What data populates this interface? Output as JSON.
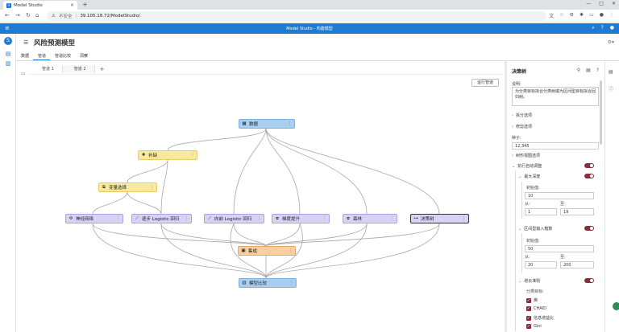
{
  "browser": {
    "tab_title": "Model Studio",
    "tab_close": "×",
    "new_tab": "+",
    "security": "不安全",
    "url": "39.105.18.72/ModelStudio/"
  },
  "app": {
    "title": "Model Studio - 构建模型"
  },
  "project": {
    "title": "风险预测模型",
    "tabs": [
      "数据",
      "管道",
      "管道比较",
      "洞察"
    ]
  },
  "pipeline_tabs": [
    "管道 1",
    "管道 2"
  ],
  "pipeline_add": "+",
  "canvas": {
    "run_button": "运行管道",
    "nodes": {
      "data": "数据",
      "impute": "补缺",
      "varsel": "变量选择",
      "nn": "神经网络",
      "logit_step": "逐步 Logistic 回归",
      "logit_fwd": "向前 Logistic 回归",
      "gb": "梯度提升",
      "forest": "森林",
      "tree": "决策树",
      "ensemble": "集成",
      "compare": "模型比较"
    },
    "node_menu": "⋮"
  },
  "panel": {
    "title": "决策树",
    "desc_label": "说明:",
    "desc_text": "为分类目标拟合分类树或为区间型目标拟合回归树。",
    "split_opts": "拆分选项",
    "prune_opts": "修剪选项",
    "seed_label": "种子:",
    "seed_value": "12,345",
    "tree_vis_opts": "树形视图选项",
    "autotune": "执行自动调整",
    "max_depth": "最大深度",
    "init_label": "初始值:",
    "depth_init": "10",
    "from_label": "从:",
    "to_label": "至:",
    "depth_from": "1",
    "depth_to": "19",
    "bins": "区间型输入箱数",
    "bins_init": "50",
    "bins_from": "20",
    "bins_to": "200",
    "growth": "增长准则",
    "class_target": "分类目标:",
    "criteria": [
      "熵",
      "CHAID",
      "信息增益比",
      "Gini"
    ]
  }
}
